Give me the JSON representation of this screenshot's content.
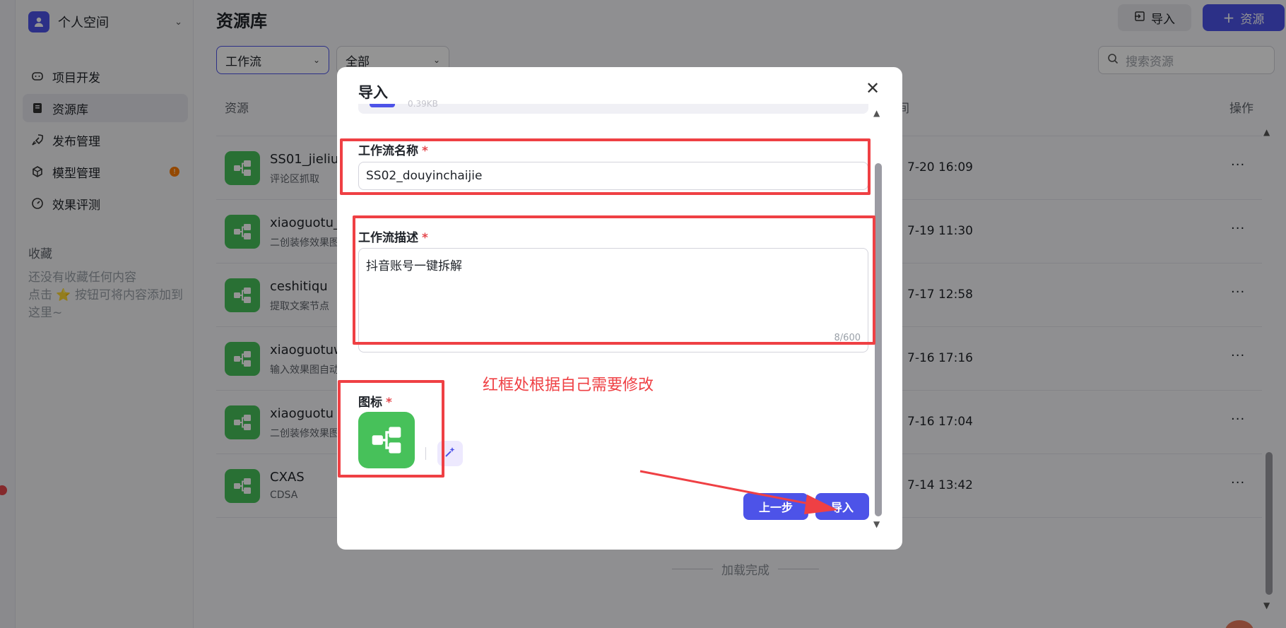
{
  "sidebar": {
    "space_name": "个人空间",
    "nav": [
      {
        "label": "项目开发",
        "icon": "gamepad-icon"
      },
      {
        "label": "资源库",
        "icon": "library-icon",
        "active": true
      },
      {
        "label": "发布管理",
        "icon": "rocket-icon"
      },
      {
        "label": "模型管理",
        "icon": "cube-icon",
        "badge": "!"
      },
      {
        "label": "效果评测",
        "icon": "gauge-icon"
      }
    ],
    "favorites_title": "收藏",
    "favorites_empty_line1": "还没有收藏任何内容",
    "favorites_empty_line2": "点击 ⭐ 按钮可将内容添加到这里~"
  },
  "header": {
    "title": "资源库",
    "import_label": "导入",
    "add_label": "资源"
  },
  "filters": {
    "type_value": "工作流",
    "scope_value": "全部",
    "search_placeholder": "搜索资源"
  },
  "table": {
    "columns": {
      "resource": "资源",
      "time": "间",
      "actions": "操作"
    },
    "rows": [
      {
        "name": "SS01_jieliu",
        "desc": "评论区抓取",
        "time": "7-20 16:09"
      },
      {
        "name": "xiaoguotu_",
        "desc": "二创装修效果图",
        "time": "7-19 11:30"
      },
      {
        "name": "ceshitiqu",
        "desc": "提取文案节点",
        "time": "7-17 12:58"
      },
      {
        "name": "xiaoguotuw",
        "desc": "输入效果图自动",
        "time": "7-16 17:16"
      },
      {
        "name": "xiaoguotu",
        "desc": "二创装修效果图",
        "time": "7-16 17:04"
      },
      {
        "name": "CXAS",
        "desc": "CDSA",
        "time": "7-14 13:42"
      }
    ],
    "more_glyph": "···",
    "loaded_text": "加载完成"
  },
  "modal": {
    "title": "导入",
    "file_size": "0.39KB",
    "name_label": "工作流名称",
    "name_value": "SS02_douyinchaijie",
    "desc_label": "工作流描述",
    "desc_value": "抖音账号一键拆解",
    "desc_count": "8/600",
    "icon_label": "图标",
    "required_mark": "*",
    "prev_label": "上一步",
    "import_label": "导入"
  },
  "annotation": {
    "note": "红框处根据自己需要修改"
  },
  "colors": {
    "brand": "#4d53e8",
    "workflow_icon": "#47c15a",
    "annotation_red": "#ef4044"
  }
}
